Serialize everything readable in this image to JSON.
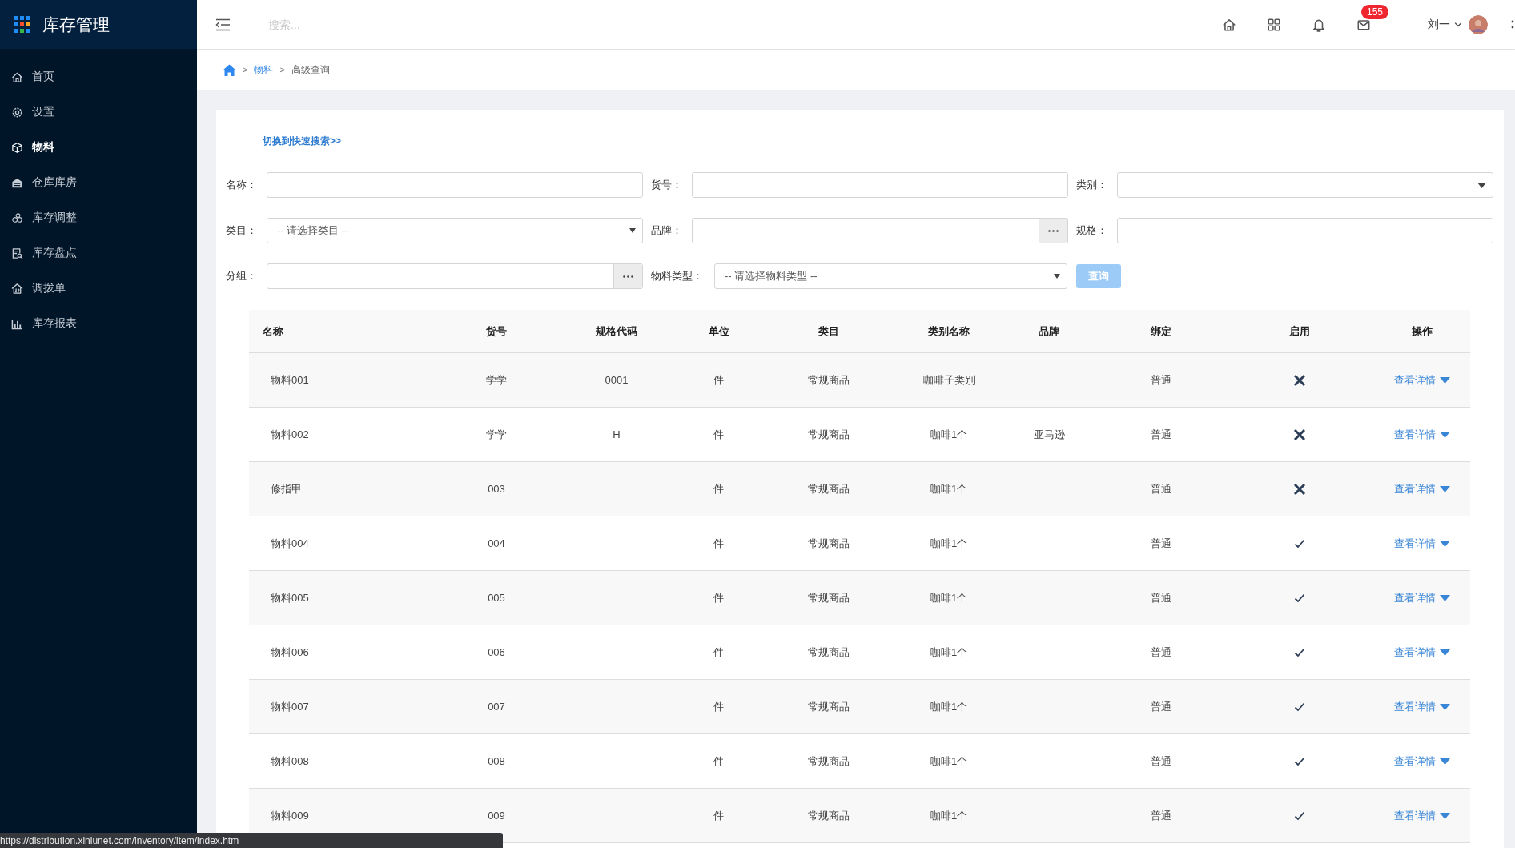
{
  "sidebar": {
    "title": "库存管理",
    "items": [
      {
        "label": "首页",
        "selected": false
      },
      {
        "label": "设置",
        "selected": false
      },
      {
        "label": "物料",
        "selected": true
      },
      {
        "label": "仓库库房",
        "selected": false
      },
      {
        "label": "库存调整",
        "selected": false
      },
      {
        "label": "库存盘点",
        "selected": false
      },
      {
        "label": "调拨单",
        "selected": false
      },
      {
        "label": "库存报表",
        "selected": false
      }
    ]
  },
  "topbar": {
    "search": {
      "placeholder": "搜索..."
    },
    "mail_badge": "155",
    "user": "刘一"
  },
  "breadcrumb": {
    "separator": ">",
    "items": [
      {
        "label": "物料",
        "link": true
      },
      {
        "label": "高级查询",
        "link": false
      }
    ]
  },
  "switch_link": "切换到快速搜索>>",
  "form": {
    "rows": [
      [
        {
          "label": "名称：",
          "kind": "text"
        },
        {
          "label": "货号：",
          "kind": "text"
        },
        {
          "label": "类别：",
          "kind": "select"
        }
      ],
      [
        {
          "label": "类目：",
          "kind": "select",
          "placeholder": "-- 请选择类目 --"
        },
        {
          "label": "品牌：",
          "kind": "picker"
        },
        {
          "label": "规格：",
          "kind": "text"
        }
      ],
      [
        {
          "label": "分组：",
          "kind": "picker"
        },
        {
          "label": "物料类型：",
          "kind": "select",
          "placeholder": "-- 请选择物料类型 --"
        }
      ]
    ],
    "query_button": "查询"
  },
  "table": {
    "columns": [
      "名称",
      "货号",
      "规格代码",
      "单位",
      "类目",
      "类别名称",
      "品牌",
      "绑定",
      "启用",
      "操作"
    ],
    "rows": [
      {
        "cells": [
          "物料001",
          "学学",
          "0001",
          "件",
          "常规商品",
          "咖啡子类别",
          "",
          "普通"
        ],
        "enabled": false,
        "action": "查看详情"
      },
      {
        "cells": [
          "物料002",
          "学学",
          "H",
          "件",
          "常规商品",
          "咖啡1个",
          "亚马逊",
          "普通"
        ],
        "enabled": false,
        "action": "查看详情"
      },
      {
        "cells": [
          "修指甲",
          "003",
          "",
          "件",
          "常规商品",
          "咖啡1个",
          "",
          "普通"
        ],
        "enabled": false,
        "action": "查看详情"
      },
      {
        "cells": [
          "物料004",
          "004",
          "",
          "件",
          "常规商品",
          "咖啡1个",
          "",
          "普通"
        ],
        "enabled": true,
        "action": "查看详情"
      },
      {
        "cells": [
          "物料005",
          "005",
          "",
          "件",
          "常规商品",
          "咖啡1个",
          "",
          "普通"
        ],
        "enabled": true,
        "action": "查看详情"
      },
      {
        "cells": [
          "物料006",
          "006",
          "",
          "件",
          "常规商品",
          "咖啡1个",
          "",
          "普通"
        ],
        "enabled": true,
        "action": "查看详情"
      },
      {
        "cells": [
          "物料007",
          "007",
          "",
          "件",
          "常规商品",
          "咖啡1个",
          "",
          "普通"
        ],
        "enabled": true,
        "action": "查看详情"
      },
      {
        "cells": [
          "物料008",
          "008",
          "",
          "件",
          "常规商品",
          "咖啡1个",
          "",
          "普通"
        ],
        "enabled": true,
        "action": "查看详情"
      },
      {
        "cells": [
          "物料009",
          "009",
          "",
          "件",
          "常规商品",
          "咖啡1个",
          "",
          "普通"
        ],
        "enabled": true,
        "action": "查看详情"
      }
    ]
  },
  "status_url": "https://distribution.xiniunet.com/inventory/item/index.htm"
}
